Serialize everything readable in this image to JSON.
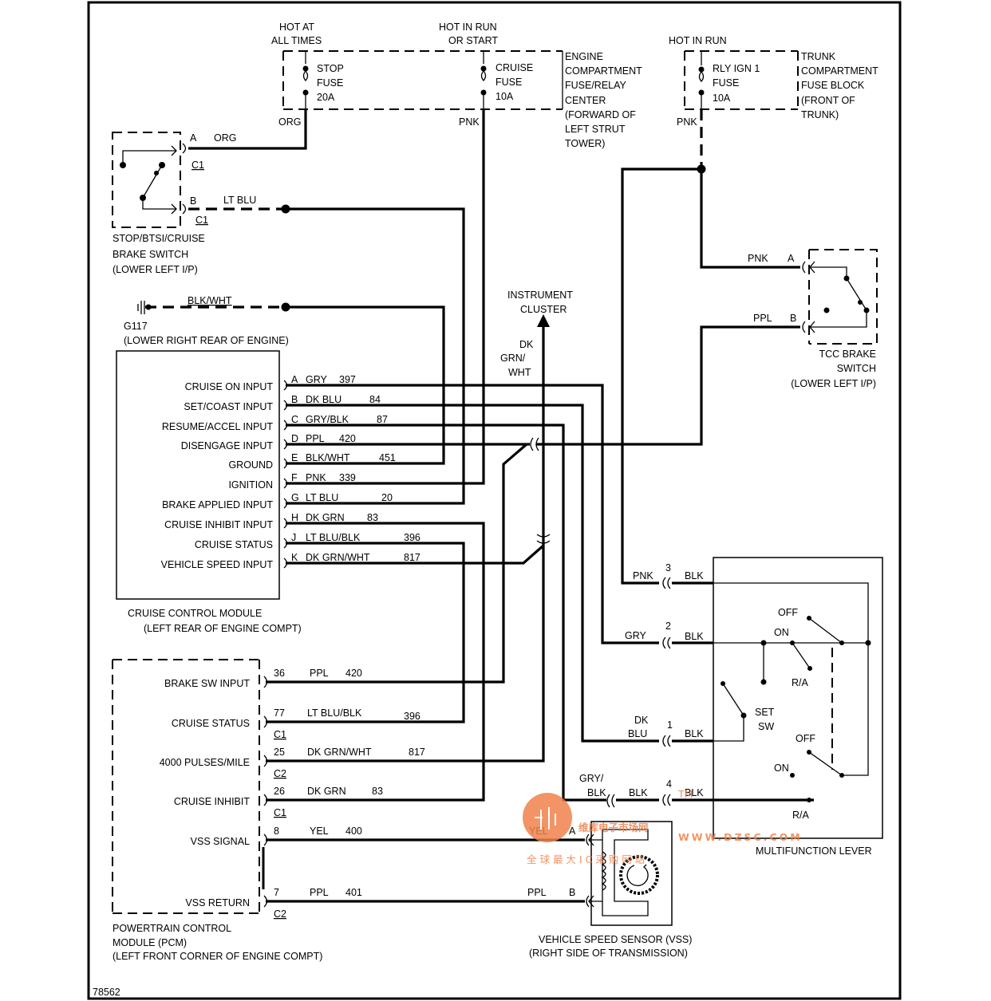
{
  "diagram": {
    "figure_id": "78562",
    "fuse_blocks": {
      "hot_at_all_times": [
        "HOT AT",
        "ALL TIMES"
      ],
      "hot_in_run_or_start": [
        "HOT IN RUN",
        "OR START"
      ],
      "hot_in_run": "HOT IN RUN",
      "stop_fuse": [
        "STOP",
        "FUSE",
        "20A"
      ],
      "cruise_fuse": [
        "CRUISE",
        "FUSE",
        "10A"
      ],
      "rly_ign_fuse": [
        "RLY IGN 1",
        "FUSE",
        "10A"
      ],
      "engine_center": [
        "ENGINE",
        "COMPARTMENT",
        "FUSE/RELAY",
        "CENTER",
        "(FORWARD OF",
        "LEFT STRUT",
        "TOWER)"
      ],
      "trunk_block": [
        "TRUNK",
        "COMPARTMENT",
        "FUSE BLOCK",
        "(FRONT OF",
        "TRUNK)"
      ],
      "wire_org": "ORG",
      "wire_pnk": "PNK",
      "wire_pnk2": "PNK"
    },
    "brake_switch": {
      "name": [
        "STOP/BTSI/CRUISE",
        "BRAKE SWITCH",
        "(LOWER LEFT I/P)"
      ],
      "pin_a": "A",
      "pin_b": "B",
      "conn_a": "C1",
      "conn_b": "C1",
      "wire_a": "ORG",
      "wire_b": "LT BLU"
    },
    "ground": {
      "wire": "BLK/WHT",
      "name": "G117",
      "location": "(LOWER RIGHT REAR OF ENGINE)"
    },
    "instrument_cluster": {
      "name": [
        "INSTRUMENT",
        "CLUSTER"
      ],
      "wire": [
        "DK",
        "GRN/",
        "WHT"
      ]
    },
    "tcc_switch": {
      "name": [
        "TCC BRAKE",
        "SWITCH",
        "(LOWER LEFT I/P)"
      ],
      "pin_a": "A",
      "pin_b": "B",
      "wire_a": "PNK",
      "wire_b": "PPL"
    },
    "cruise_module": {
      "name": "CRUISE CONTROL MODULE",
      "location": "(LEFT REAR OF  ENGINE COMPT)",
      "pins": [
        {
          "label": "CRUISE ON INPUT",
          "pin": "A",
          "wire": "GRY",
          "circuit": "397"
        },
        {
          "label": "SET/COAST INPUT",
          "pin": "B",
          "wire": "DK BLU",
          "circuit": "84"
        },
        {
          "label": "RESUME/ACCEL INPUT",
          "pin": "C",
          "wire": "GRY/BLK",
          "circuit": "87"
        },
        {
          "label": "DISENGAGE INPUT",
          "pin": "D",
          "wire": "PPL",
          "circuit": "420"
        },
        {
          "label": "GROUND",
          "pin": "E",
          "wire": "BLK/WHT",
          "circuit": "451"
        },
        {
          "label": "IGNITION",
          "pin": "F",
          "wire": "PNK",
          "circuit": "339"
        },
        {
          "label": "BRAKE APPLIED INPUT",
          "pin": "G",
          "wire": "LT BLU",
          "circuit": "20"
        },
        {
          "label": "CRUISE INHIBIT INPUT",
          "pin": "H",
          "wire": "DK GRN",
          "circuit": "83"
        },
        {
          "label": "CRUISE STATUS",
          "pin": "J",
          "wire": "LT BLU/BLK",
          "circuit": "396"
        },
        {
          "label": "VEHICLE SPEED INPUT",
          "pin": "K",
          "wire": "DK GRN/WHT",
          "circuit": "817"
        }
      ]
    },
    "pcm": {
      "name": [
        "POWERTRAIN CONTROL",
        "MODULE (PCM)",
        "(LEFT FRONT CORNER OF ENGINE COMPT)"
      ],
      "pins": [
        {
          "label": "BRAKE SW INPUT",
          "pin": "36",
          "wire": "PPL",
          "circuit": "420",
          "conn": ""
        },
        {
          "label": "CRUISE STATUS",
          "pin": "77",
          "wire": "LT BLU/BLK",
          "circuit": "396",
          "conn": "C1"
        },
        {
          "label": "4000 PULSES/MILE",
          "pin": "25",
          "wire": "DK GRN/WHT",
          "circuit": "817",
          "conn": "C2"
        },
        {
          "label": "CRUISE INHIBIT",
          "pin": "26",
          "wire": "DK GRN",
          "circuit": "83",
          "conn": "C1"
        },
        {
          "label": "VSS SIGNAL",
          "pin": "8",
          "wire": "YEL",
          "circuit": "400",
          "conn": ""
        },
        {
          "label": "VSS RETURN",
          "pin": "7",
          "wire": "PPL",
          "circuit": "401",
          "conn": "C2"
        }
      ]
    },
    "multifunction_lever": {
      "name": "MULTIFUNCTION LEVER",
      "connections": [
        {
          "pin": "3",
          "wire_in": "PNK",
          "wire_out": "BLK"
        },
        {
          "pin": "2",
          "wire_in": "GRY",
          "wire_out": "BLK"
        },
        {
          "pin": "1",
          "wire_in": [
            "DK",
            "BLU"
          ],
          "wire_out": "BLK"
        },
        {
          "pin": "4",
          "wire_in": [
            "GRY/",
            "BLK"
          ],
          "wire_mid": "BLK",
          "wire_out": "BLK"
        }
      ],
      "switch_labels": {
        "off_top": "OFF",
        "on_top": "ON",
        "ra_top": "R/A",
        "set_sw": [
          "SET",
          "SW"
        ],
        "off_bottom": "OFF",
        "on_bottom": "ON",
        "ra_bottom": "R/A"
      }
    },
    "vss": {
      "name": [
        "VEHICLE SPEED SENSOR (VSS)",
        "(RIGHT SIDE OF TRANSMISSION)"
      ],
      "pin_a": "A",
      "pin_b": "B",
      "wire_a": "YEL",
      "wire_b": "PPL"
    },
    "watermark": {
      "title": "维库电子市场网",
      "url": "WWW.DZSC.COM",
      "slogan": "全 球 最 大 I C 采 购 网 站",
      "tm": "TM",
      "color": "#f0814a"
    }
  }
}
